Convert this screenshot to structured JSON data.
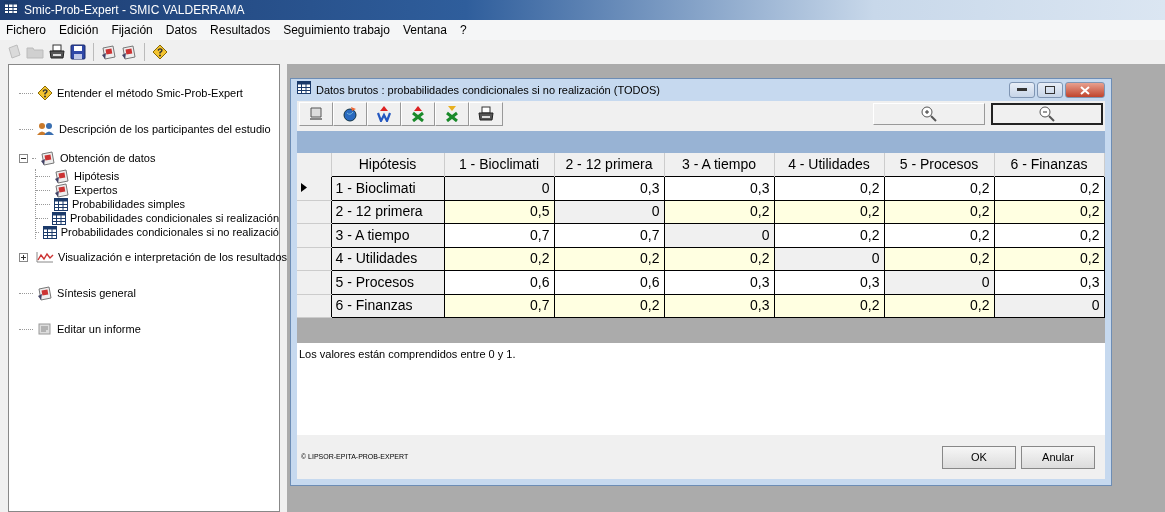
{
  "window": {
    "title": "Smic-Prob-Expert  -  SMIC VALDERRAMA"
  },
  "menu": [
    "Fichero",
    "Edición",
    "Fijación",
    "Datos",
    "Resultados",
    "Seguimiento trabajo",
    "Ventana",
    "?"
  ],
  "toolbar": [
    {
      "kind": "new",
      "disabled": true
    },
    {
      "kind": "open",
      "disabled": true
    },
    {
      "kind": "print",
      "disabled": false
    },
    {
      "kind": "save",
      "disabled": false
    },
    {
      "kind": "sep"
    },
    {
      "kind": "doc",
      "disabled": false
    },
    {
      "kind": "doc",
      "disabled": false
    },
    {
      "kind": "sep"
    },
    {
      "kind": "help",
      "disabled": false
    }
  ],
  "tree": [
    {
      "label": "Entender el método Smic-Prob-Expert",
      "kind": "help"
    },
    {
      "label": "Descripción de los participantes del estudio",
      "kind": "people"
    },
    {
      "label": "Obtención de datos",
      "kind": "doc",
      "expanded": true,
      "children": [
        {
          "label": "Hipótesis",
          "kind": "doc"
        },
        {
          "label": "Expertos",
          "kind": "doc"
        },
        {
          "label": "Probabilidades simples",
          "kind": "table"
        },
        {
          "label": "Probabilidades condicionales si realización",
          "kind": "table"
        },
        {
          "label": "Probabilidades condicionales si no realizació",
          "kind": "table"
        }
      ]
    },
    {
      "label": "Visualización e interpretación de los resultados",
      "kind": "chart",
      "expanded": false
    },
    {
      "label": "Síntesis general",
      "kind": "doc"
    },
    {
      "label": "Editar un informe",
      "kind": "report"
    }
  ],
  "dialog": {
    "title": "Datos brutos : probabilidades condicionales si no realización (TODOS)",
    "toolbar": [
      {
        "kind": "monitor"
      },
      {
        "kind": "globe"
      },
      {
        "kind": "export-w"
      },
      {
        "kind": "export-x"
      },
      {
        "kind": "import-x"
      },
      {
        "kind": "print"
      }
    ],
    "zoom_buttons": [
      {
        "kind": "zoom-in",
        "selected": false
      },
      {
        "kind": "zoom-out",
        "selected": true
      }
    ],
    "table": {
      "columns": [
        "Hipótesis",
        "1 - Bioclimati",
        "2 - 12 primera",
        "3 - A tiempo",
        "4 - Utilidades",
        "5 - Procesos",
        "6 - Finanzas"
      ],
      "rows": [
        {
          "selected": true,
          "banded": false,
          "cells": [
            "1 - Bioclimati",
            "0",
            "0,3",
            "0,3",
            "0,2",
            "0,2",
            "0,2"
          ]
        },
        {
          "selected": false,
          "banded": true,
          "cells": [
            "2 - 12 primera",
            "0,5",
            "0",
            "0,2",
            "0,2",
            "0,2",
            "0,2"
          ]
        },
        {
          "selected": false,
          "banded": false,
          "cells": [
            "3 - A tiempo",
            "0,7",
            "0,7",
            "0",
            "0,2",
            "0,2",
            "0,2"
          ]
        },
        {
          "selected": false,
          "banded": true,
          "cells": [
            "4 - Utilidades",
            "0,2",
            "0,2",
            "0,2",
            "0",
            "0,2",
            "0,2"
          ]
        },
        {
          "selected": false,
          "banded": false,
          "cells": [
            "5 - Procesos",
            "0,6",
            "0,6",
            "0,3",
            "0,3",
            "0",
            "0,3"
          ]
        },
        {
          "selected": false,
          "banded": true,
          "cells": [
            "6 - Finanzas",
            "0,7",
            "0,2",
            "0,3",
            "0,2",
            "0,2",
            "0"
          ]
        }
      ]
    },
    "note": "Los valores están comprendidos entre 0 y 1.",
    "copyright": "© LIPSOR-EPITA-PROB-EXPERT",
    "buttons": [
      "OK",
      "Anular"
    ]
  }
}
